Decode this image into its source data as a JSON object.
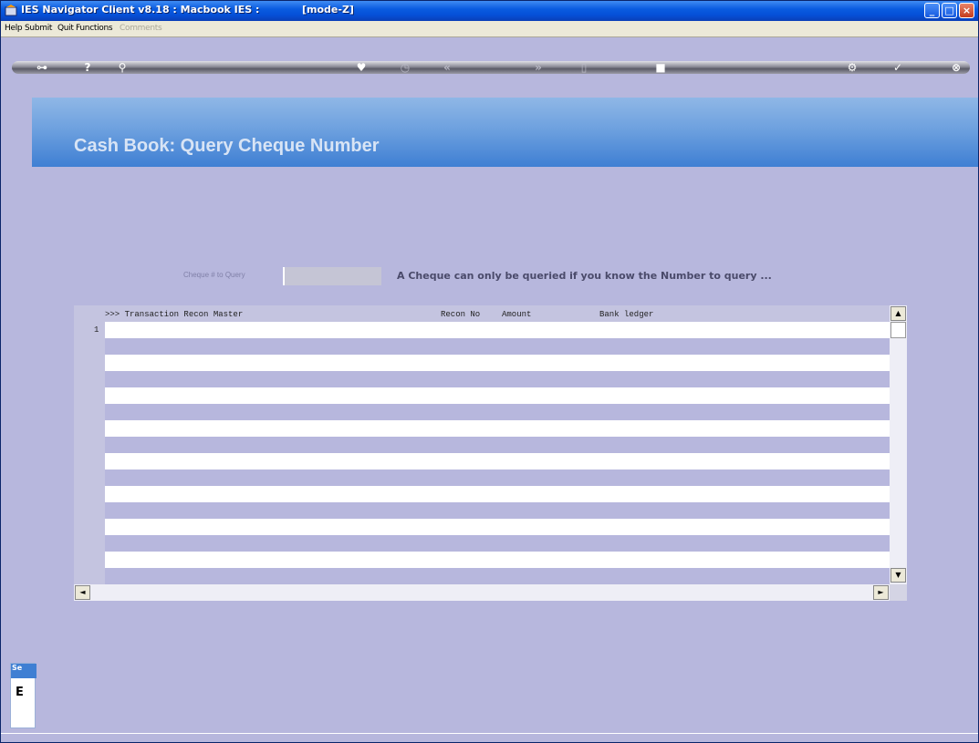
{
  "window": {
    "title": "IES Navigator Client v8.18 : Macbook IES :",
    "mode": "[mode-Z]",
    "controls": {
      "minimize": "_",
      "maximize": "□",
      "close": "×"
    }
  },
  "menu": {
    "items": [
      "Help",
      "Submit",
      "Quit",
      "Functions",
      "Comments"
    ]
  },
  "toolbar": {
    "buttons": [
      {
        "icon": "key-icon",
        "glyph": "⊶"
      },
      {
        "icon": "help-icon",
        "glyph": "?"
      },
      {
        "icon": "search-icon",
        "glyph": "⚲"
      },
      {
        "icon": "heart-icon",
        "glyph": "♥"
      },
      {
        "icon": "clock-icon",
        "glyph": "◷"
      },
      {
        "icon": "rewind-icon",
        "glyph": "«"
      },
      {
        "icon": "forward-icon",
        "glyph": "»"
      },
      {
        "icon": "document-icon",
        "glyph": "▯"
      },
      {
        "icon": "stop-icon",
        "glyph": "■"
      },
      {
        "icon": "settings-icon",
        "glyph": "⚙"
      },
      {
        "icon": "check-icon",
        "glyph": "✓"
      },
      {
        "icon": "close-icon",
        "glyph": "⊗"
      }
    ]
  },
  "banner": {
    "title": "Cash Book: Query Cheque Number"
  },
  "query": {
    "label": "Cheque # to Query",
    "value": "",
    "hint": "A Cheque can only be queried if you know the Number to query ..."
  },
  "grid": {
    "columns": [
      ">>> Transaction Recon Master",
      "Recon No",
      "Amount",
      "Bank ledger"
    ],
    "row_number": "1",
    "scroll": {
      "up": "▲",
      "down": "▼",
      "left": "◄",
      "right": "►"
    }
  },
  "side_widget": {
    "tab": "Se",
    "text": "E"
  },
  "colors": {
    "background": "#b7b7dd",
    "banner": "#3f7fd3",
    "titlebar": "#0550d8"
  }
}
